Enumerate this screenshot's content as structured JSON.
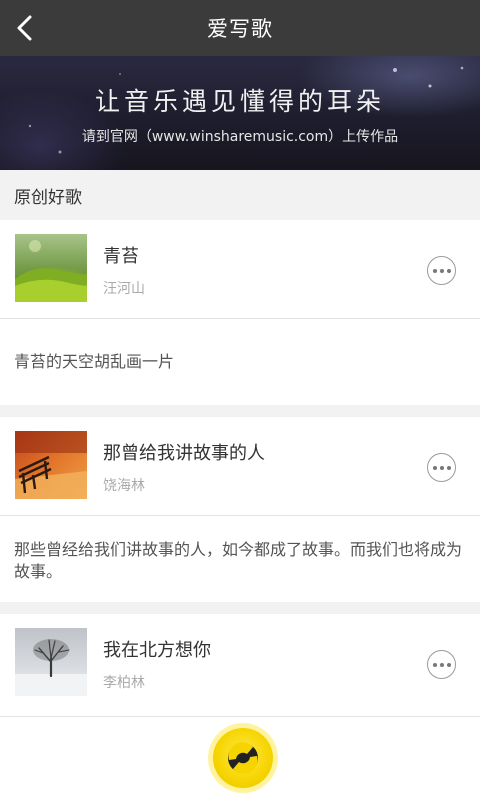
{
  "header": {
    "title": "爱写歌",
    "back_icon": "back-arrow-icon"
  },
  "banner": {
    "slogan": "让音乐遇见懂得的耳朵",
    "subtitle": "请到官网（www.winsharemusic.com）上传作品"
  },
  "section": {
    "title": "原创好歌"
  },
  "songs": [
    {
      "title": "青苔",
      "artist": "汪河山",
      "description": "青苔的天空胡乱画一片",
      "thumbnail": "moss-photo"
    },
    {
      "title": "那曾给我讲故事的人",
      "artist": "饶海林",
      "description": "那些曾经给我们讲故事的人，如今都成了故事。而我们也将成为故事。",
      "thumbnail": "autumn-bench-photo"
    },
    {
      "title": "我在北方想你",
      "artist": "李柏林",
      "thumbnail": "snow-tree-photo"
    }
  ],
  "more_icon": "more-dots-icon",
  "bottom": {
    "button_icon": "music-disc-icon",
    "accent": "#f6d400"
  },
  "colors": {
    "topbar": "#3b3b3b",
    "background": "#f2f2f2"
  }
}
